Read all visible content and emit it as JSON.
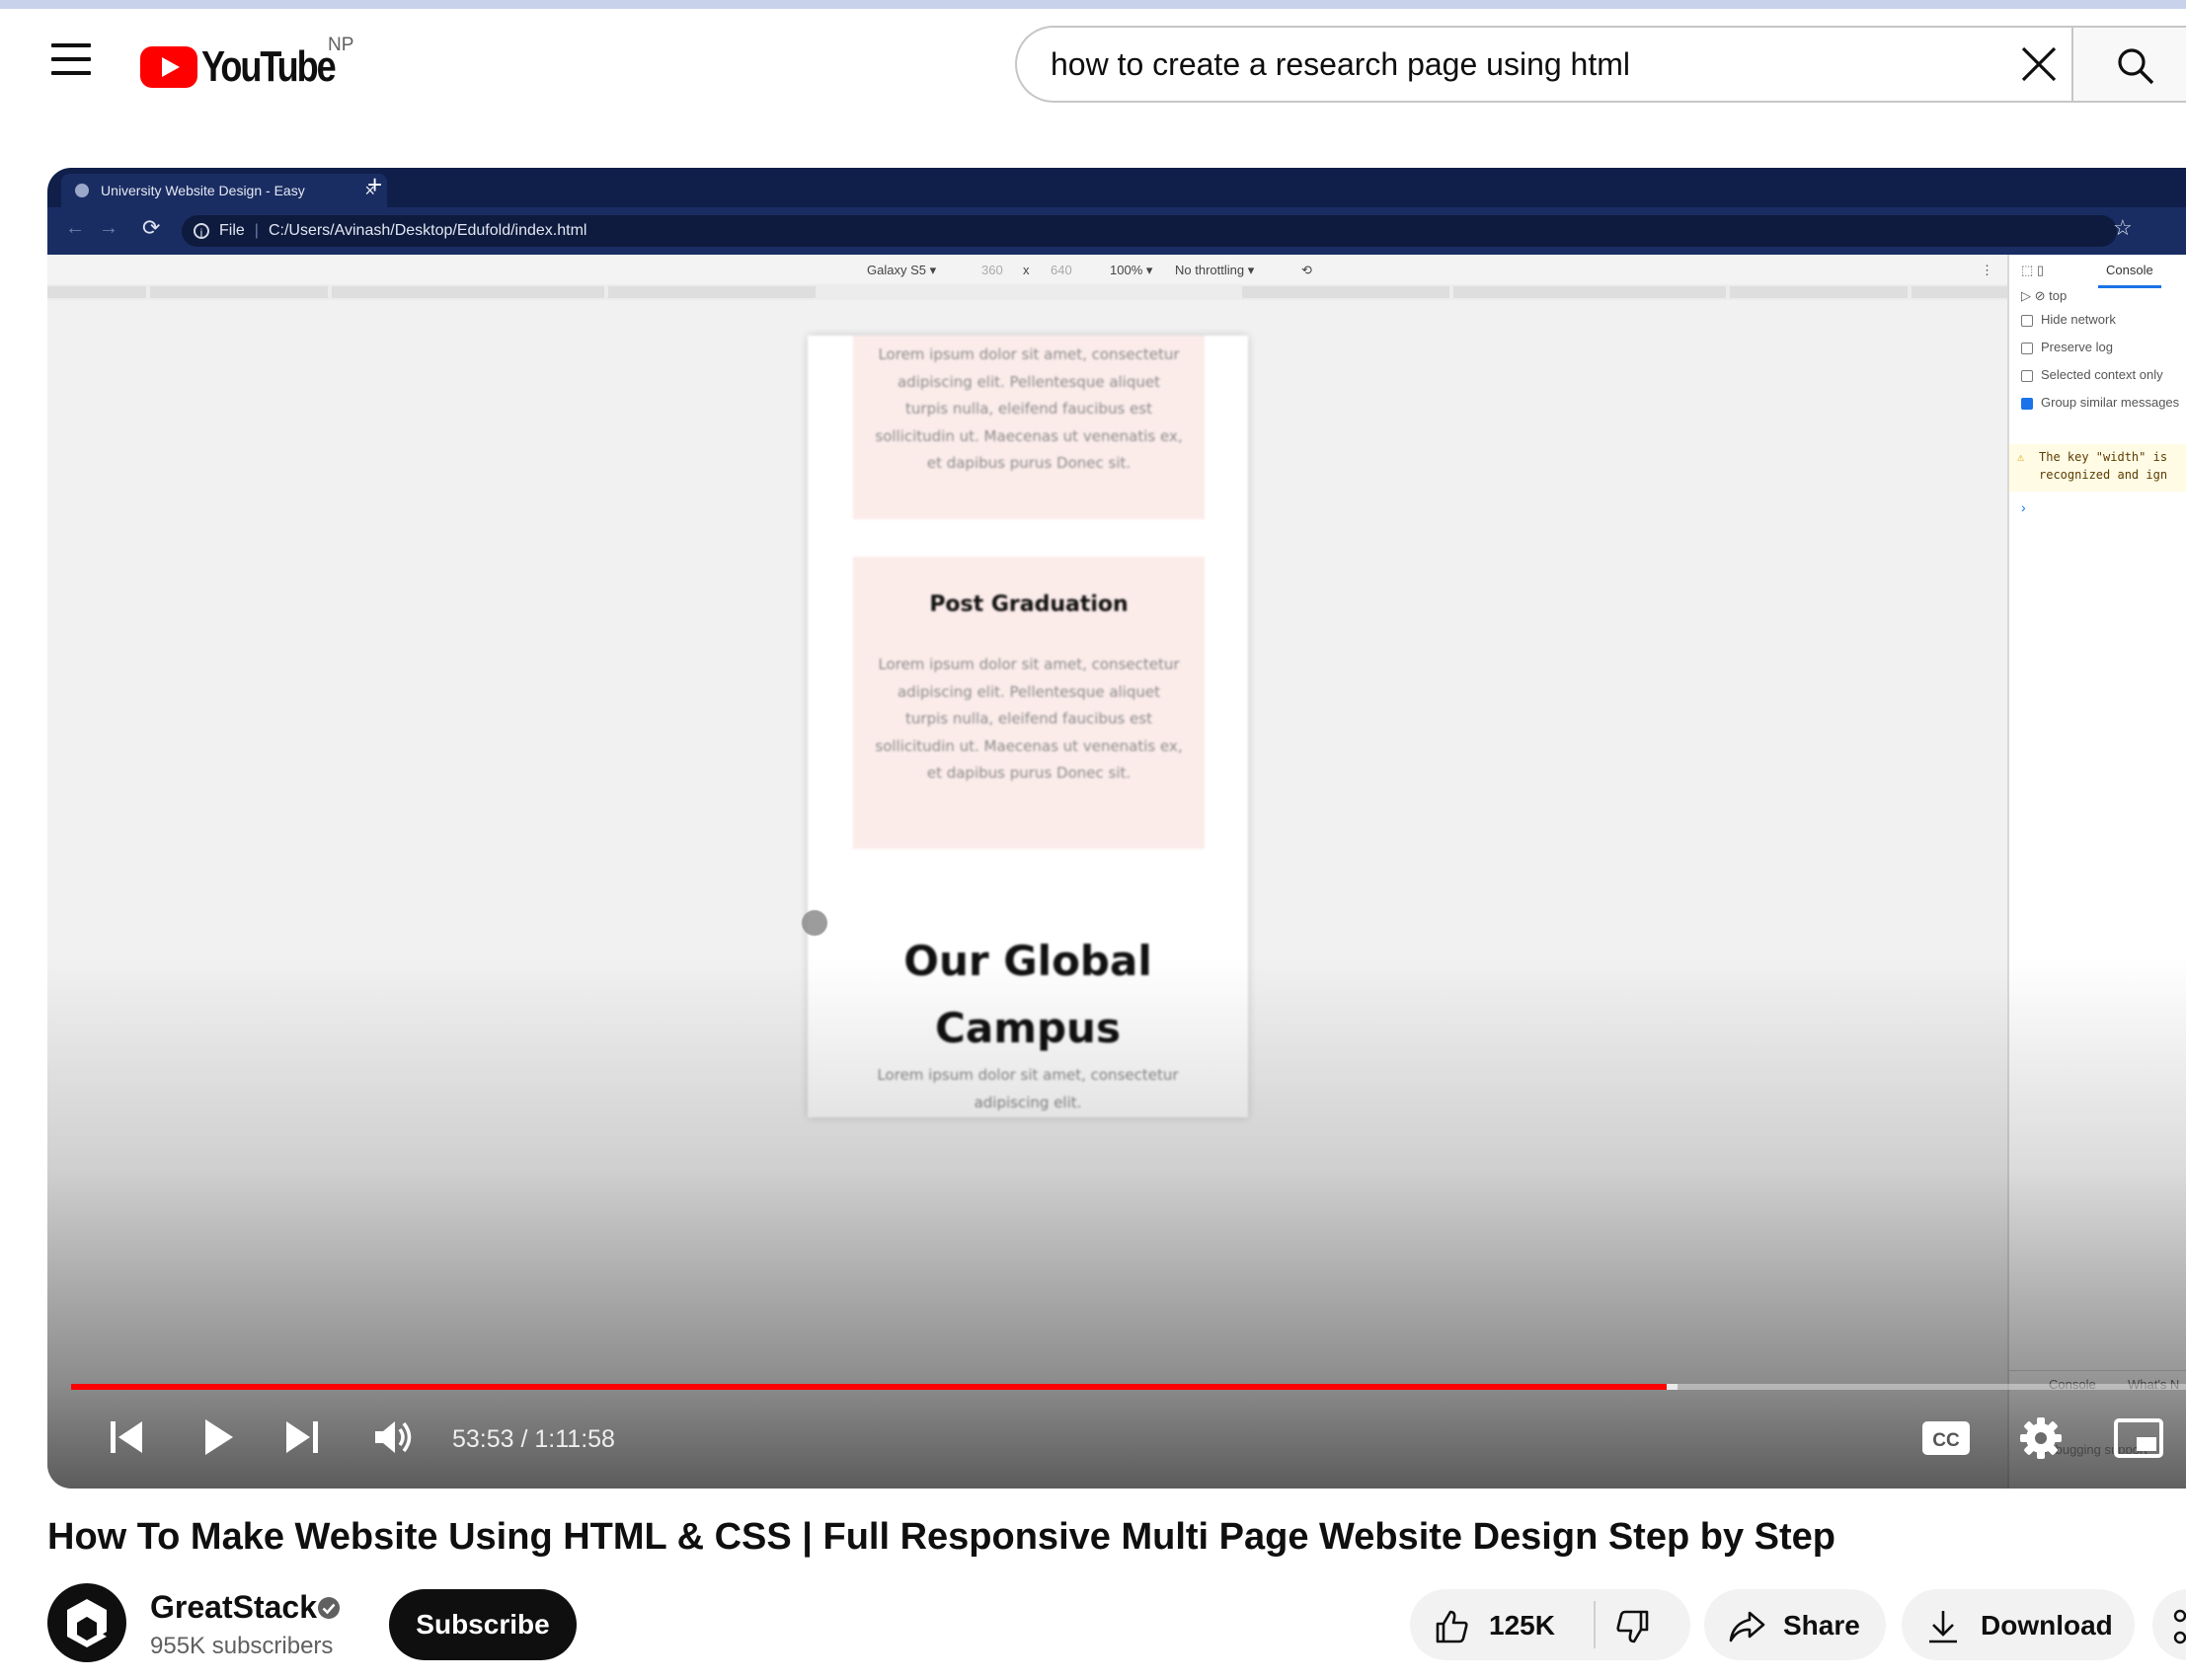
{
  "masthead": {
    "logo_text": "YouTube",
    "country_code": "NP",
    "search_query": "how to create a research page using html"
  },
  "player": {
    "browser": {
      "tab_title": "University Website Design - Easy",
      "url_scheme_label": "File",
      "url_path": "C:/Users/Avinash/Desktop/Edufold/index.html"
    },
    "devtools": {
      "device": "Galaxy S5 ▾",
      "width": "360",
      "times": "x",
      "height": "640",
      "zoom": "100% ▾",
      "throttling": "No throttling ▾",
      "console_tab": "Console",
      "context": "top",
      "options": [
        {
          "label": "Hide network",
          "checked": false
        },
        {
          "label": "Preserve log",
          "checked": false
        },
        {
          "label": "Selected context only",
          "checked": false
        },
        {
          "label": "Group similar messages",
          "checked": true
        }
      ],
      "warning_line1": "The key \"width\" is",
      "warning_line2": "recognized and ign",
      "bottom_tab1": "Console",
      "bottom_tab2": "What's N",
      "bottom_extra": "Debugging support"
    },
    "page": {
      "lorem": "Lorem ipsum dolor sit amet, consectetur adipiscing elit. Pellentesque aliquet turpis nulla, eleifend faucibus est sollicitudin ut. Maecenas ut venenatis ex, et dapibus purus Donec sit.",
      "card_title": "Post Graduation",
      "section_title": "Our Global Campus",
      "section_lorem": "Lorem ipsum dolor sit amet, consectetur adipiscing elit."
    },
    "progress_fraction": 0.7494,
    "buffered_fraction": 0.7545,
    "accent": "#ff0000",
    "current_time": "53:53",
    "duration": "1:11:58",
    "time_separator": " / ",
    "cc_label": "CC"
  },
  "video": {
    "title": "How To Make Website Using HTML & CSS | Full Responsive Multi Page Website Design Step by Step",
    "channel_name": "GreatStack",
    "subscribers": "955K subscribers",
    "subscribe_label": "Subscribe",
    "likes": "125K",
    "share_label": "Share",
    "download_label": "Download"
  },
  "icons": [
    "menu-icon",
    "youtube-logo-icon",
    "clear-icon",
    "search-icon",
    "previous-icon",
    "play-icon",
    "next-icon",
    "volume-icon",
    "captions-icon",
    "settings-icon",
    "miniplayer-icon",
    "verified-icon",
    "thumb-up-icon",
    "thumb-down-icon",
    "share-icon",
    "download-icon",
    "more-icon"
  ]
}
